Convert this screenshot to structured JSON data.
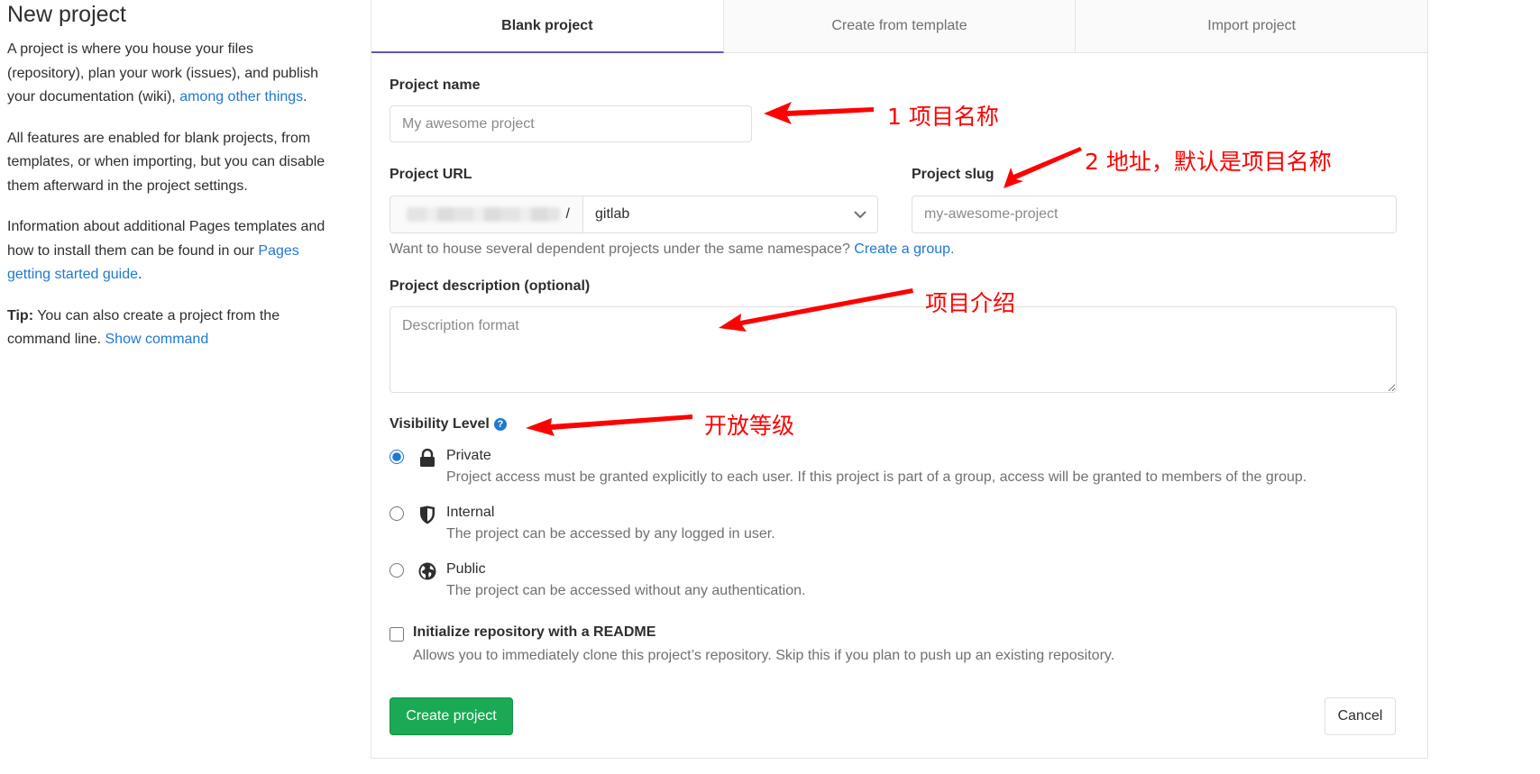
{
  "info": {
    "title": "New project",
    "p1_text": "A project is where you house your files (repository), plan your work (issues), and publish your documentation (wiki), ",
    "p1_link": "among other things",
    "p1_end": ".",
    "p2_text": "All features are enabled for blank projects, from templates, or when importing, but you can disable them afterward in the project settings.",
    "p3_text": "Information about additional Pages templates and how to install them can be found in our ",
    "p3_link": "Pages getting started guide",
    "p3_end": ".",
    "tip_label": "Tip:",
    "tip_text": " You can also create a project from the command line. ",
    "tip_link": "Show command"
  },
  "tabs": [
    "Blank project",
    "Create from template",
    "Import project"
  ],
  "form": {
    "name_label": "Project name",
    "name_placeholder": "My awesome project",
    "url_label": "Project URL",
    "url_separator": "/",
    "namespace_value": "gitlab",
    "slug_label": "Project slug",
    "slug_placeholder": "my-awesome-project",
    "help_text": "Want to house several dependent projects under the same namespace? ",
    "help_link": "Create a group.",
    "desc_label": "Project description (optional)",
    "desc_placeholder": "Description format",
    "visibility_label": "Visibility Level",
    "visibility_help": "?",
    "visibility_options": [
      {
        "title": "Private",
        "desc": "Project access must be granted explicitly to each user. If this project is part of a group, access will be granted to members of the group."
      },
      {
        "title": "Internal",
        "desc": "The project can be accessed by any logged in user."
      },
      {
        "title": "Public",
        "desc": "The project can be accessed without any authentication."
      }
    ],
    "readme_title": "Initialize repository with a README",
    "readme_desc": "Allows you to immediately clone this project’s repository. Skip this if you plan to push up an existing repository.",
    "create_button": "Create project",
    "cancel_button": "Cancel"
  },
  "annotations": {
    "a1": "1  项目名称",
    "a2": "2 地址，默认是项目名称",
    "a3": "项目介绍",
    "a4": "开放等级"
  },
  "colors": {
    "accent": "#1f78d1",
    "primary_button": "#1aaa55",
    "tab_active_border": "#6b4fbb",
    "annotation": "#ff0000"
  }
}
